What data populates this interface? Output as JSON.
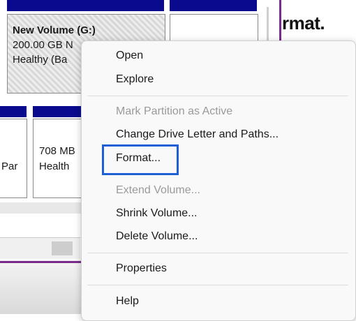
{
  "volume": {
    "title": "New Volume  (G:)",
    "size": "200.00 GB N",
    "status": "Healthy (Ba"
  },
  "partition": {
    "label_fragment": "Par",
    "size": "708 MB",
    "status": "Health"
  },
  "background_heading_fragment": "rmat.",
  "context_menu": {
    "items": [
      {
        "label": "Open",
        "enabled": true
      },
      {
        "label": "Explore",
        "enabled": true
      },
      {
        "label": "Mark Partition as Active",
        "enabled": false
      },
      {
        "label": "Change Drive Letter and Paths...",
        "enabled": true
      },
      {
        "label": "Format...",
        "enabled": true,
        "highlighted": true
      },
      {
        "label": "Extend Volume...",
        "enabled": false
      },
      {
        "label": "Shrink Volume...",
        "enabled": true
      },
      {
        "label": "Delete Volume...",
        "enabled": true
      },
      {
        "label": "Properties",
        "enabled": true
      },
      {
        "label": "Help",
        "enabled": true
      }
    ]
  },
  "colors": {
    "header_blue": "#0a0a8e",
    "accent_purple": "#7a2c8c",
    "highlight_blue": "#1f5fd6",
    "disabled_text": "#9a9a9a"
  }
}
